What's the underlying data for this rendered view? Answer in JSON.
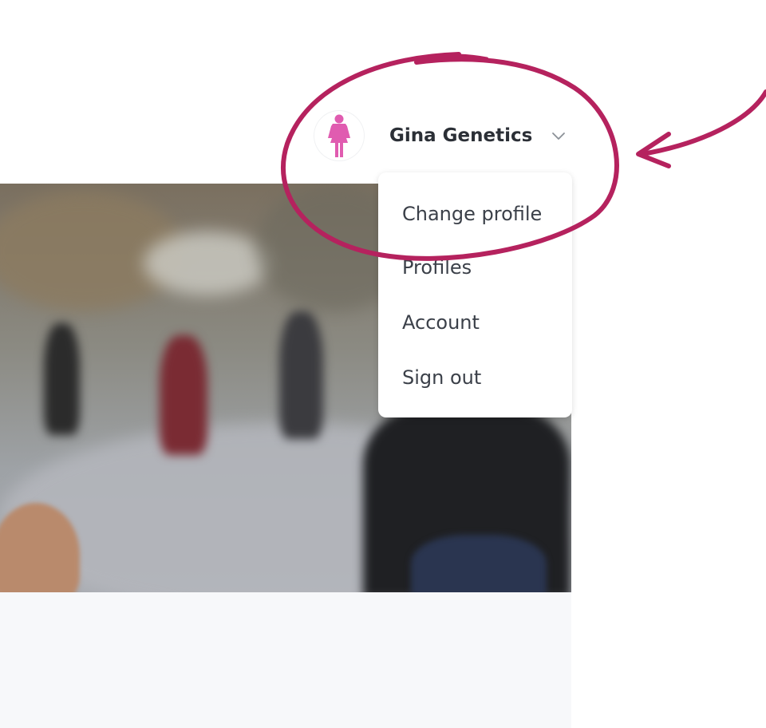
{
  "header": {
    "user_name": "Gina Genetics",
    "avatar_icon": "female-figure-icon",
    "chevron_icon": "chevron-down-icon"
  },
  "dropdown": {
    "items": [
      {
        "label": "Change profile"
      },
      {
        "label": "Profiles"
      },
      {
        "label": "Account"
      },
      {
        "label": "Sign out"
      }
    ]
  },
  "colors": {
    "annotation": "#b5225e",
    "avatar_figure": "#e05cb0",
    "text_primary": "#2b2f36",
    "menu_text": "#3b4049",
    "lower_panel": "#f7f8fa"
  },
  "annotation": {
    "circle_icon": "highlight-circle",
    "arrow_icon": "curved-arrow-icon"
  }
}
